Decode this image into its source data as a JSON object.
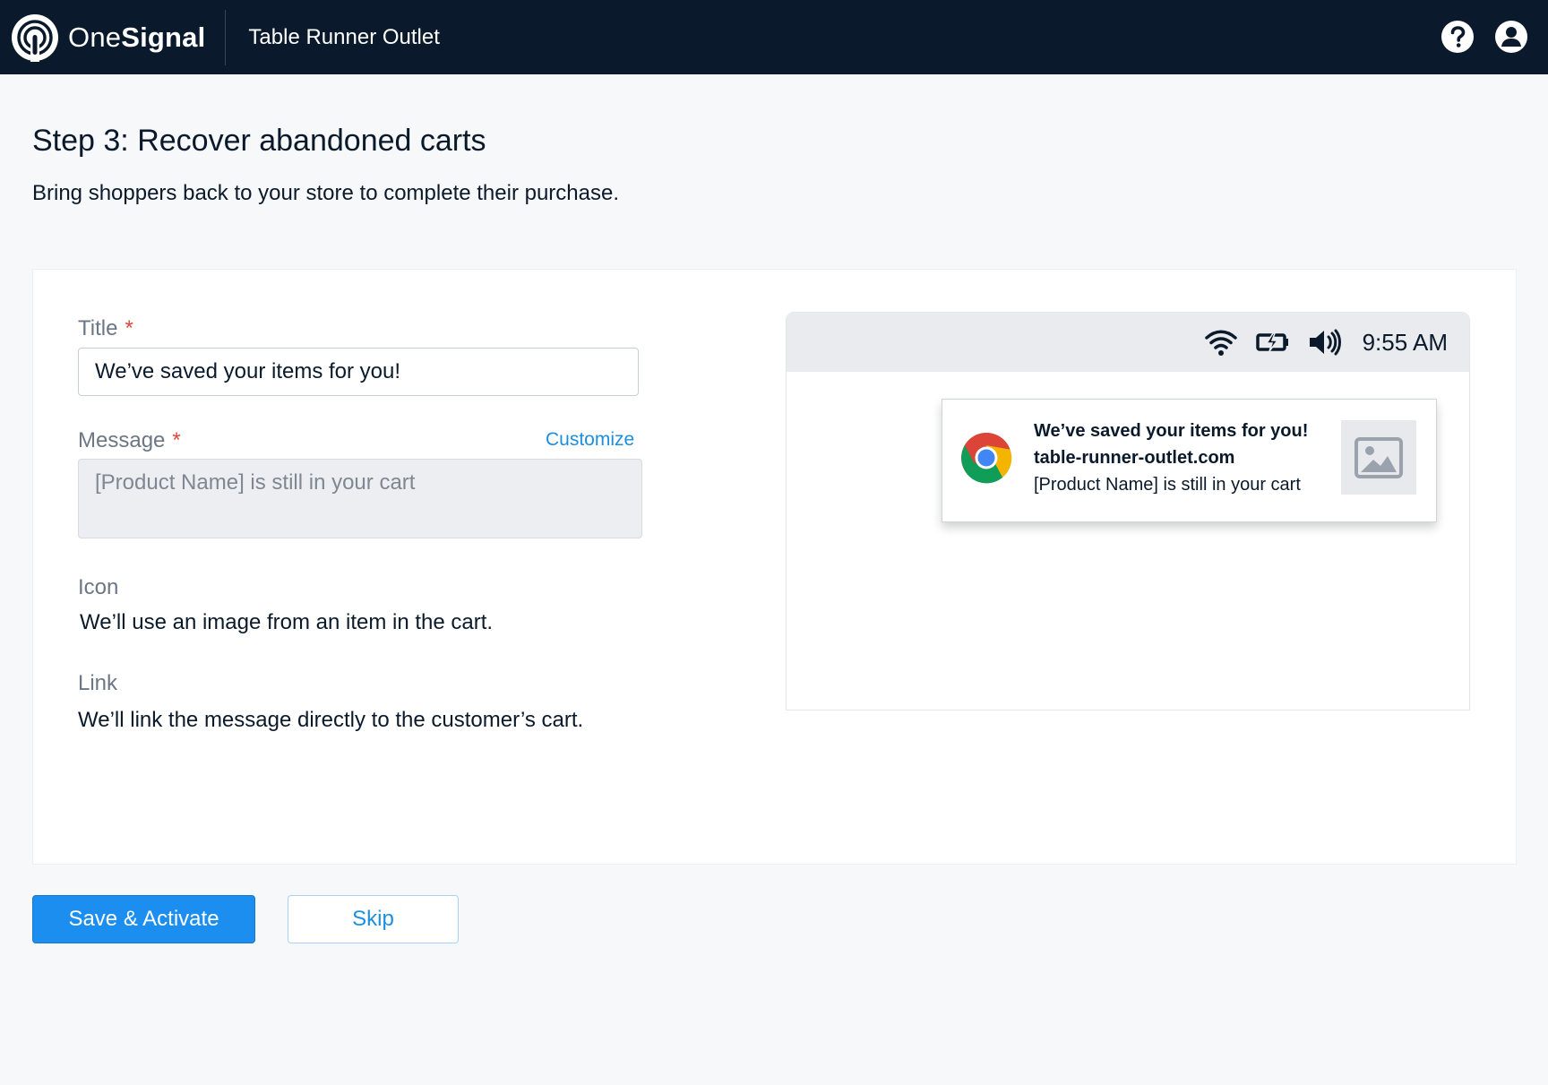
{
  "header": {
    "logo_light": "One",
    "logo_bold": "Signal",
    "app_name": "Table Runner Outlet",
    "help_icon": "help-circle-icon",
    "account_icon": "user-circle-icon"
  },
  "page": {
    "title": "Step 3: Recover abandoned carts",
    "subtitle": "Bring shoppers back to your store to complete their purchase."
  },
  "form": {
    "title_label": "Title",
    "title_value": "We’ve saved your items for you!",
    "required_mark": "*",
    "message_label": "Message",
    "customize_link": "Customize",
    "message_value": "[Product Name] is still in your cart",
    "icon_label": "Icon",
    "icon_text": "We’ll use an image from an item in the cart.",
    "link_label": "Link",
    "link_text": "We’ll link the message directly to the customer’s cart."
  },
  "preview": {
    "status_time": "9:55 AM",
    "status_icons": [
      "wifi-icon",
      "battery-charging-icon",
      "volume-icon"
    ],
    "notification": {
      "browser_icon": "chrome-icon",
      "title": "We’ve saved your items for you!",
      "site": "table-runner-outlet.com",
      "body": "[Product Name] is still in your cart",
      "image_icon": "image-placeholder-icon"
    }
  },
  "actions": {
    "primary": "Save & Activate",
    "secondary": "Skip"
  },
  "colors": {
    "topbar": "#0a1a2c",
    "accent": "#1b8ef0",
    "required": "#e0443b",
    "background": "#f7f8fa"
  }
}
